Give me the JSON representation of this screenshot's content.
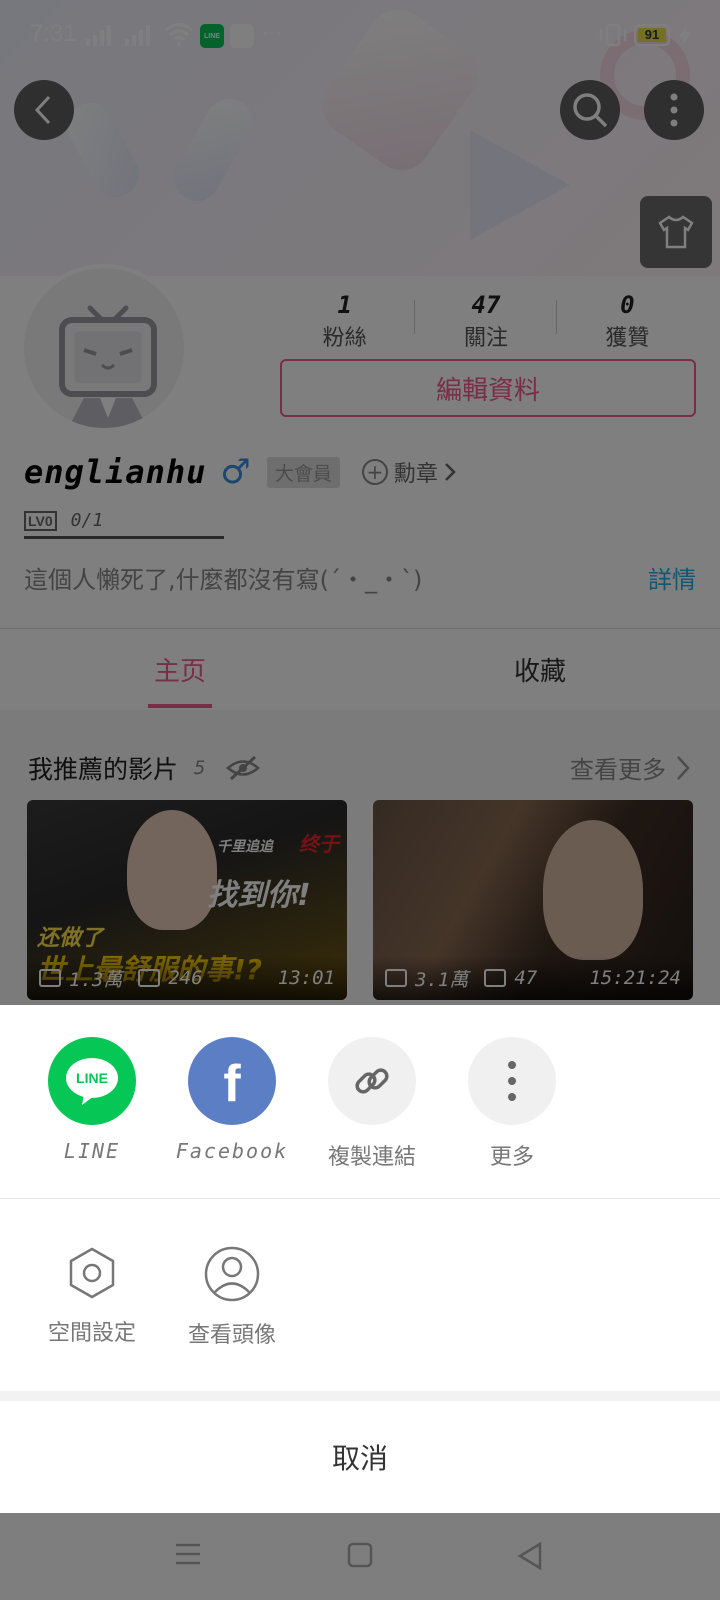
{
  "status_bar": {
    "time": "7:31",
    "battery": "91",
    "line_badge": "LINE",
    "more_dots": "···"
  },
  "profile": {
    "stats": [
      {
        "value": "1",
        "label": "粉絲"
      },
      {
        "value": "47",
        "label": "關注"
      },
      {
        "value": "0",
        "label": "獲贊"
      }
    ],
    "edit_label": "編輯資料",
    "username": "englianhu",
    "gender_symbol": "♂",
    "vip_tag": "大會員",
    "medal_label": "勳章",
    "level_badge": "LV0",
    "exp": "0/1",
    "bio": "這個人懶死了,什麼都沒有寫(ˊ・_・ˋ)",
    "bio_detail": "詳情"
  },
  "tabs": [
    {
      "label": "主页",
      "active": true
    },
    {
      "label": "收藏",
      "active": false
    }
  ],
  "recommend": {
    "title": "我推薦的影片",
    "count": "5",
    "more": "查看更多",
    "videos": [
      {
        "views": "1.3萬",
        "danmaku": "246",
        "duration": "13:01",
        "thumb_texts": [
          "千里追追",
          "终于",
          "找到你!",
          "还做了",
          "世上最舒服的事!?"
        ]
      },
      {
        "views": "3.1萬",
        "danmaku": "47",
        "duration": "15:21:24"
      }
    ]
  },
  "share_sheet": {
    "share_targets": [
      {
        "label": "LINE",
        "icon": "line-icon",
        "badge": "LINE",
        "color": "#06c755"
      },
      {
        "label": "Facebook",
        "icon": "facebook-icon",
        "badge": "f",
        "color": "#5b7ec4"
      },
      {
        "label": "複製連結",
        "icon": "link-icon",
        "color": "#f0f0f0"
      },
      {
        "label": "更多",
        "icon": "more-vertical-icon",
        "color": "#f0f0f0"
      }
    ],
    "functions": [
      {
        "label": "空間設定",
        "icon": "hexagon-settings-icon"
      },
      {
        "label": "查看頭像",
        "icon": "user-circle-icon"
      }
    ],
    "cancel_label": "取消"
  },
  "colors": {
    "accent_pink": "#f25d8e",
    "link_blue": "#23ade5",
    "line_green": "#06c755",
    "facebook_blue": "#5b7ec4"
  }
}
